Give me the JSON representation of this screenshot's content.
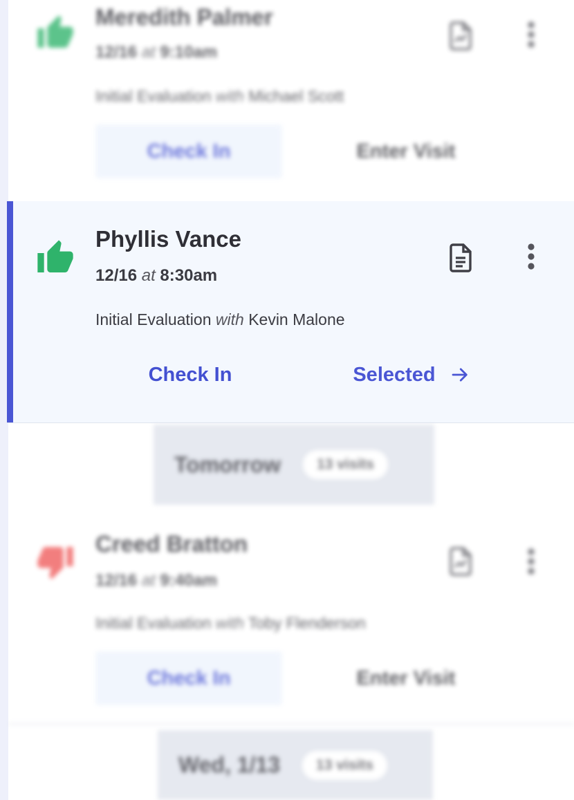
{
  "appointments": [
    {
      "patient": "Meredith Palmer",
      "time": "12/16",
      "time_at": "at",
      "clock": "9:10am",
      "visit_type": "Initial Evaluation",
      "with_word": "with",
      "provider": "Michael Scott",
      "rating": "thumbs-up",
      "primary_action": "Check In",
      "secondary_action": "Enter Visit"
    },
    {
      "patient": "Phyllis Vance",
      "time": "12/16",
      "time_at": "at",
      "clock": "8:30am",
      "visit_type": "Initial Evaluation",
      "with_word": "with",
      "provider": "Kevin Malone",
      "rating": "thumbs-up",
      "primary_action": "Check In",
      "secondary_action": "Selected"
    },
    {
      "patient": "Creed Bratton",
      "time": "12/16",
      "time_at": "at",
      "clock": "9:40am",
      "visit_type": "Initial Evaluation",
      "with_word": "with",
      "provider": "Toby Flenderson",
      "rating": "thumbs-down",
      "primary_action": "Check In",
      "secondary_action": "Enter Visit"
    }
  ],
  "day_groups": [
    {
      "label": "Tomorrow",
      "count": "13 visits"
    },
    {
      "label": "Wed, 1/13",
      "count": "13 visits"
    }
  ],
  "colors": {
    "accent": "#4a56d4",
    "thumbs_up": "#2fb36b",
    "thumbs_down": "#ef5a5a",
    "selected_bg": "#f4f8fe"
  },
  "icons": {
    "document": "document-icon",
    "menu": "more-vertical-icon",
    "arrow": "arrow-right-icon"
  }
}
